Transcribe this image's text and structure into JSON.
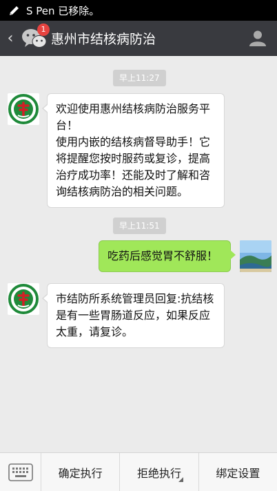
{
  "status_bar": {
    "notification": "S Pen 已移除。"
  },
  "header": {
    "back_icon": "back-icon",
    "app_icon": "wechat-icon",
    "badge_count": "1",
    "title": "惠州市结核病防治",
    "profile_icon": "person-icon"
  },
  "messages": [
    {
      "type": "time",
      "text": "早上11:27"
    },
    {
      "type": "incoming",
      "text": "欢迎使用惠州结核病防治服务平台！\n使用内嵌的结核病督导助手！它将提醒您按时服药或复诊，提高治疗成功率！还能及时了解和咨询结核病防治的相关问题。"
    },
    {
      "type": "time",
      "text": "早上11:51"
    },
    {
      "type": "outgoing",
      "text": "吃药后感觉胃不舒服！"
    },
    {
      "type": "incoming",
      "text": "市结防所系统管理员回复:抗结核是有一些胃肠道反应，如果反应太重，请复诊。"
    }
  ],
  "bottom_menu": {
    "keyboard_icon": "keyboard-icon",
    "items": [
      {
        "label": "确定执行"
      },
      {
        "label": "拒绝执行"
      },
      {
        "label": "绑定设置"
      }
    ]
  },
  "colors": {
    "title_bar": "#393a3f",
    "chat_bg": "#ebebeb",
    "outgoing_bubble": "#a0e759",
    "badge": "#e64340",
    "logo_green": "#1f8a3a",
    "logo_red": "#d21f26"
  }
}
